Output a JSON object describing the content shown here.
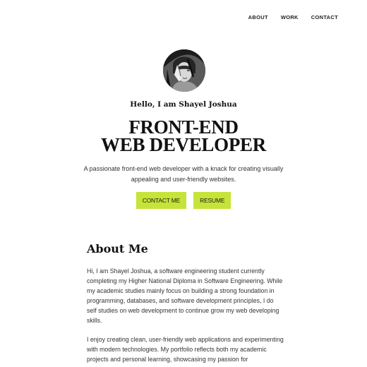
{
  "nav": {
    "items": [
      "ABOUT",
      "WORK",
      "CONTACT"
    ]
  },
  "hero": {
    "greeting": "Hello, I am Shayel Joshua",
    "headline_line1": "FRONT-END",
    "headline_line2": "WEB DEVELOPER",
    "tagline": "A passionate front-end web developer with a knack for creating visually appealing and user-friendly websites.",
    "buttons": {
      "contact_label": "CONTACT ME",
      "resume_label": "RESUME"
    }
  },
  "about": {
    "title": "About Me",
    "paragraph1": "Hi, I am Shayel Joshua, a software engineering student currently completing my Higher National Diploma in Software Engineering. While my academic studies mainly focus on building a strong foundation in programming, databases, and software development principles, I do self studies on web development to continue grow my web developing skills.",
    "paragraph2": "I enjoy creating clean, user-friendly web applications and experimenting with modern technologies. My portfolio reflects both my academic projects and personal learning, showcasing my passion for"
  },
  "colors": {
    "accent": "#c6e339",
    "text": "#1a1a1a",
    "background": "#ffffff"
  },
  "icons": {
    "avatar": "profile-photo"
  }
}
